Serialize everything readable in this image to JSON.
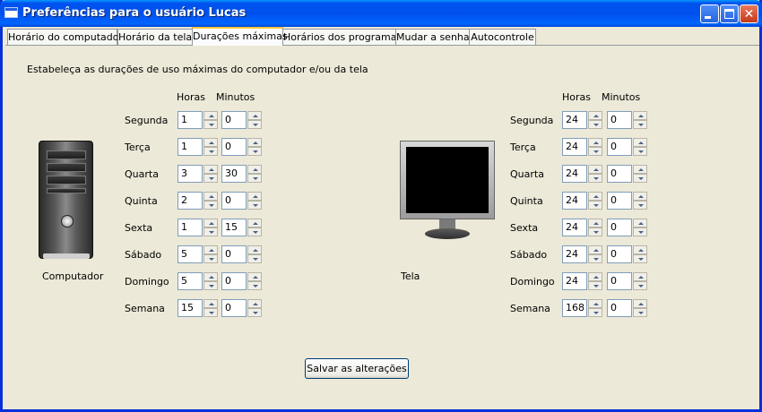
{
  "window": {
    "title": "Preferências para o usuário Lucas",
    "close_glyph": "✕"
  },
  "tabs": [
    {
      "label": "Horário do computador",
      "active": false
    },
    {
      "label": "Horário da tela",
      "active": false
    },
    {
      "label": "Durações máximas",
      "active": true
    },
    {
      "label": "Horários dos programas",
      "active": false
    },
    {
      "label": "Mudar a senha",
      "active": false
    },
    {
      "label": "Autocontrole",
      "active": false
    }
  ],
  "instruction": "Estabeleça as durações de uso máximas do computador e/ou da tela",
  "computer": {
    "label": "Computador",
    "headers": {
      "hours": "Horas",
      "minutes": "Minutos"
    },
    "rows": [
      {
        "day": "Segunda",
        "hours": "1",
        "minutes": "0"
      },
      {
        "day": "Terça",
        "hours": "1",
        "minutes": "0"
      },
      {
        "day": "Quarta",
        "hours": "3",
        "minutes": "30"
      },
      {
        "day": "Quinta",
        "hours": "2",
        "minutes": "0"
      },
      {
        "day": "Sexta",
        "hours": "1",
        "minutes": "15"
      },
      {
        "day": "Sábado",
        "hours": "5",
        "minutes": "0"
      },
      {
        "day": "Domingo",
        "hours": "5",
        "minutes": "0"
      },
      {
        "day": "Semana",
        "hours": "15",
        "minutes": "0"
      }
    ]
  },
  "screen": {
    "label": "Tela",
    "headers": {
      "hours": "Horas",
      "minutes": "Minutos"
    },
    "rows": [
      {
        "day": "Segunda",
        "hours": "24",
        "minutes": "0"
      },
      {
        "day": "Terça",
        "hours": "24",
        "minutes": "0"
      },
      {
        "day": "Quarta",
        "hours": "24",
        "minutes": "0"
      },
      {
        "day": "Quinta",
        "hours": "24",
        "minutes": "0"
      },
      {
        "day": "Sexta",
        "hours": "24",
        "minutes": "0"
      },
      {
        "day": "Sábado",
        "hours": "24",
        "minutes": "0"
      },
      {
        "day": "Domingo",
        "hours": "24",
        "minutes": "0"
      },
      {
        "day": "Semana",
        "hours": "168",
        "minutes": "0"
      }
    ]
  },
  "save_button": "Salvar as alterações",
  "icons": {
    "computer": "computer-tower-icon",
    "screen": "monitor-icon",
    "app": "window-app-icon"
  },
  "colors": {
    "titlebar": "#0054e3",
    "window_bg": "#ece9d8",
    "active_tab_accent": "#ffc83c"
  }
}
